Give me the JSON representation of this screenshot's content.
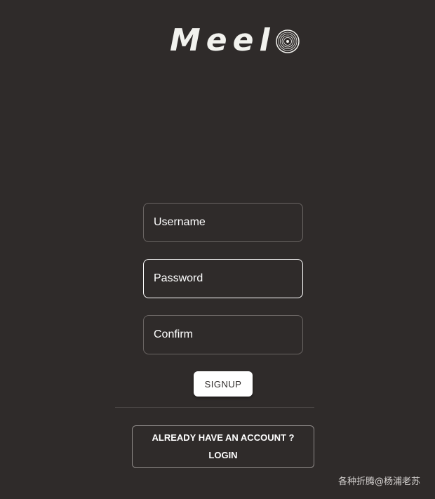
{
  "logo": {
    "text": "Meel",
    "icon": "vinyl-record-icon"
  },
  "form": {
    "username_placeholder": "Username",
    "password_placeholder": "Password",
    "confirm_placeholder": "Confirm",
    "username_value": "",
    "password_value": "",
    "confirm_value": "",
    "signup_label": "SIGNUP"
  },
  "login": {
    "line1": "ALREADY HAVE AN ACCOUNT ?",
    "line2": "LOGIN"
  },
  "watermark": "各种折腾@杨浦老苏",
  "colors": {
    "background": "#2f2b2a",
    "text": "#ffffff",
    "field_border": "#6a6563",
    "focused_border": "#ffffff"
  }
}
